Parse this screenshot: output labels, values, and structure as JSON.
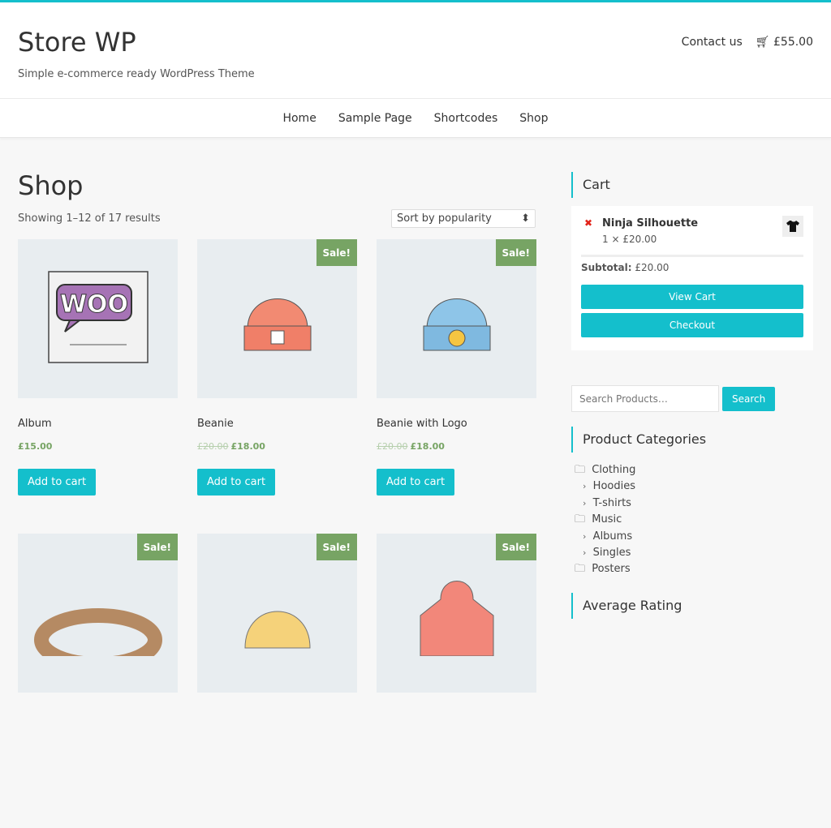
{
  "site": {
    "title": "Store WP",
    "tagline": "Simple e-commerce ready WordPress Theme",
    "contact": "Contact us",
    "cart_total": "£55.00"
  },
  "nav": [
    "Home",
    "Sample Page",
    "Shortcodes",
    "Shop"
  ],
  "shop": {
    "title": "Shop",
    "result_count": "Showing 1–12 of 17 results",
    "sort": "Sort by popularity",
    "add_label": "Add to cart",
    "sale_label": "Sale!",
    "products": [
      {
        "name": "Album",
        "price": "£15.00",
        "old": "",
        "sale": false,
        "icon": "woo-album"
      },
      {
        "name": "Beanie",
        "price": "£18.00",
        "old": "£20.00",
        "sale": true,
        "icon": "beanie-orange"
      },
      {
        "name": "Beanie with Logo",
        "price": "£18.00",
        "old": "£20.00",
        "sale": true,
        "icon": "beanie-blue"
      },
      {
        "name": "",
        "sale": true,
        "icon": "belt"
      },
      {
        "name": "",
        "sale": true,
        "icon": "cap"
      },
      {
        "name": "",
        "sale": true,
        "icon": "hoodie"
      }
    ]
  },
  "sidebar": {
    "cart_title": "Cart",
    "item_name": "Ninja Silhouette",
    "item_qty": "1 × £20.00",
    "subtotal_label": "Subtotal:",
    "subtotal": "£20.00",
    "view_cart": "View Cart",
    "checkout": "Checkout",
    "search_placeholder": "Search Products…",
    "search_button": "Search",
    "categories_title": "Product Categories",
    "categories": [
      {
        "label": "Clothing",
        "level": 0
      },
      {
        "label": "Hoodies",
        "level": 1
      },
      {
        "label": "T-shirts",
        "level": 1
      },
      {
        "label": "Music",
        "level": 0
      },
      {
        "label": "Albums",
        "level": 1
      },
      {
        "label": "Singles",
        "level": 1
      },
      {
        "label": "Posters",
        "level": 0
      }
    ],
    "rating_title": "Average Rating"
  },
  "colors": {
    "accent": "#14bfcc",
    "sale": "#77a464",
    "remove": "#e2231a"
  }
}
